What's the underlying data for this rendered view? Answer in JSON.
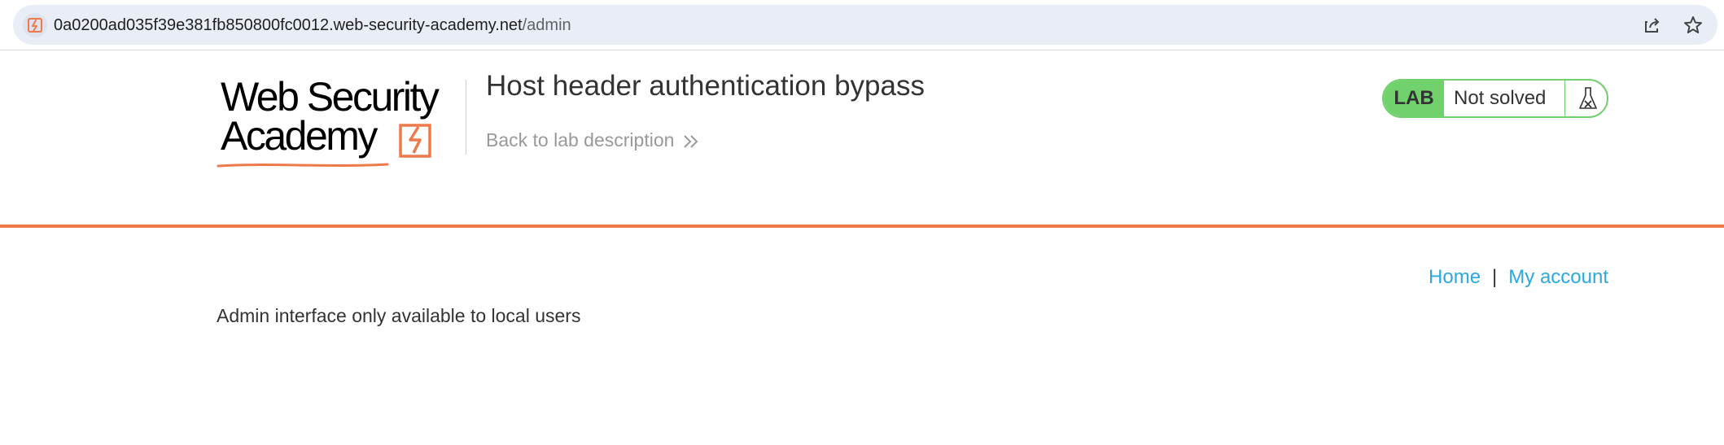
{
  "browser": {
    "url_host": "0a0200ad035f39e381fb850800fc0012.web-security-academy.net",
    "url_path": "/admin",
    "site_icon": "lightning-bolt-icon",
    "share_icon": "share-icon",
    "bookmark_icon": "star-icon"
  },
  "header": {
    "logo_line1": "Web Security",
    "logo_line2": "Academy",
    "lab_title": "Host header authentication bypass",
    "back_link": "Back to lab description",
    "back_icon": "double-chevron-right-icon",
    "lab_badge": "LAB",
    "lab_status": "Not solved",
    "status_icon": "flask-icon"
  },
  "nav": {
    "home": "Home",
    "separator": "|",
    "my_account": "My account"
  },
  "main": {
    "message": "Admin interface only available to local users"
  },
  "colors": {
    "accent": "#ee7a4c",
    "link": "#29a9df",
    "lab_green": "#70d16d",
    "text": "#333333",
    "muted": "#999999"
  }
}
